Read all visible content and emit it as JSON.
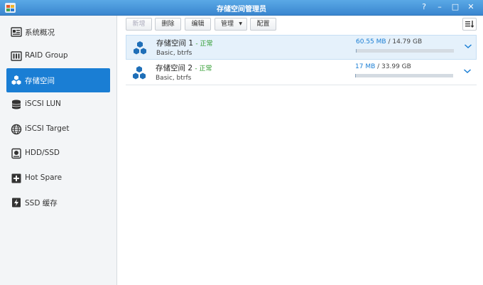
{
  "window": {
    "title": "存储空间管理员",
    "buttons": [
      "?",
      "–",
      "□",
      "✕"
    ]
  },
  "sidebar": {
    "items": [
      {
        "label": "系统概况",
        "icon": "overview-icon",
        "active": false
      },
      {
        "label": "RAID Group",
        "icon": "raid-group-icon",
        "active": false
      },
      {
        "label": "存储空间",
        "icon": "volume-cubes-icon",
        "active": true
      },
      {
        "label": "iSCSI LUN",
        "icon": "iscsi-lun-icon",
        "active": false
      },
      {
        "label": "iSCSI Target",
        "icon": "iscsi-target-icon",
        "active": false
      },
      {
        "label": "HDD/SSD",
        "icon": "hdd-icon",
        "active": false
      },
      {
        "label": "Hot Spare",
        "icon": "hot-spare-icon",
        "active": false
      },
      {
        "label": "SSD 缓存",
        "icon": "ssd-cache-icon",
        "active": false
      }
    ]
  },
  "toolbar": {
    "create_label": "新增",
    "delete_label": "删除",
    "edit_label": "编辑",
    "manage_label": "管理",
    "config_label": "配置"
  },
  "volumes": [
    {
      "name": "存储空间 1",
      "status": "正常",
      "sub": "Basic, btrfs",
      "used": "60.55 MB",
      "total": "14.79 GB",
      "usage_fraction": 0.004
    },
    {
      "name": "存储空间 2",
      "status": "正常",
      "sub": "Basic, btrfs",
      "used": "17 MB",
      "total": "33.99 GB",
      "usage_fraction": 0.0005
    }
  ],
  "colors": {
    "accent": "#1a7ed4",
    "status_ok": "#2e9b2e"
  }
}
